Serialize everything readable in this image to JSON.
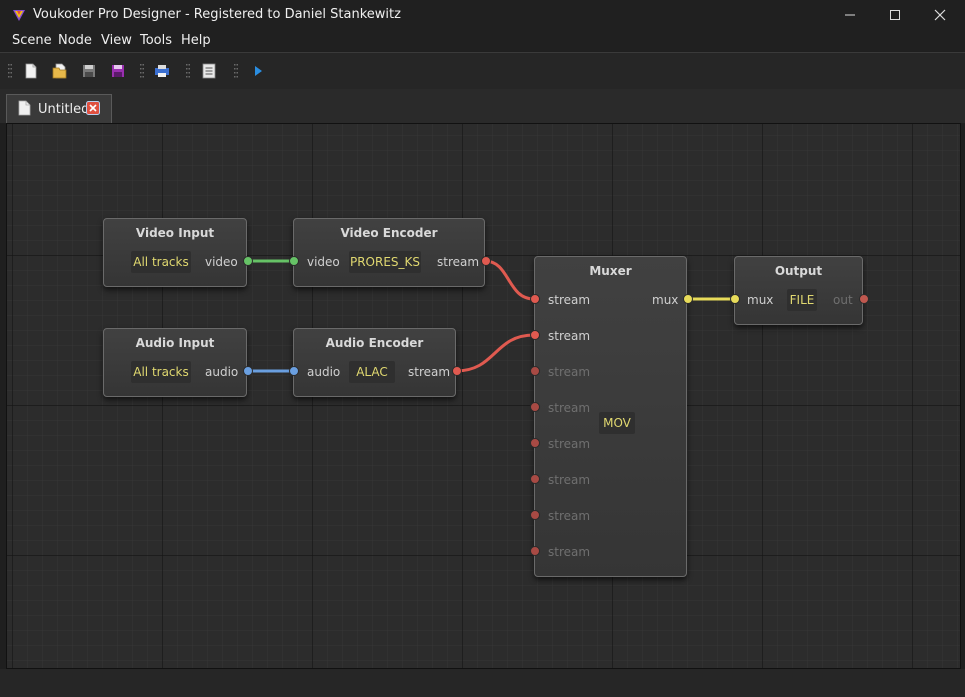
{
  "window": {
    "title": "Voukoder Pro Designer - Registered to Daniel Stankewitz",
    "controls": {
      "minimize": "minimize-icon",
      "maximize": "maximize-icon",
      "close": "close-icon"
    }
  },
  "menu": [
    "Scene",
    "Node",
    "View",
    "Tools",
    "Help"
  ],
  "toolbar": {
    "buttons": [
      "new-file-icon",
      "open-folder-icon",
      "save-icon",
      "save-as-icon",
      "properties-icon",
      "document-icon",
      "play-icon"
    ]
  },
  "tabs": [
    {
      "label": "Untitled",
      "icon": "document-icon",
      "close_icon": "close-icon"
    }
  ],
  "nodes": {
    "video_input": {
      "title": "Video Input",
      "value": "All tracks",
      "out_port": "video"
    },
    "audio_input": {
      "title": "Audio Input",
      "value": "All tracks",
      "out_port": "audio"
    },
    "video_encoder": {
      "title": "Video Encoder",
      "in_port": "video",
      "value": "PRORES_KS",
      "out_port": "stream"
    },
    "audio_encoder": {
      "title": "Audio Encoder",
      "in_port": "audio",
      "value": "ALAC",
      "out_port": "stream"
    },
    "muxer": {
      "title": "Muxer",
      "in_ports": [
        "stream",
        "stream",
        "stream",
        "stream",
        "stream",
        "stream",
        "stream",
        "stream"
      ],
      "value": "MOV",
      "out_port": "mux"
    },
    "output": {
      "title": "Output",
      "in_port": "mux",
      "value": "FILE",
      "out_port": "out"
    }
  },
  "colors": {
    "video_link": "#66c266",
    "audio_link": "#6a9fe0",
    "stream_link": "#e05a50",
    "mux_link": "#e8dc5a",
    "value_text": "#e0d870",
    "grid": "#141414",
    "canvas": "#2c2c2c"
  }
}
